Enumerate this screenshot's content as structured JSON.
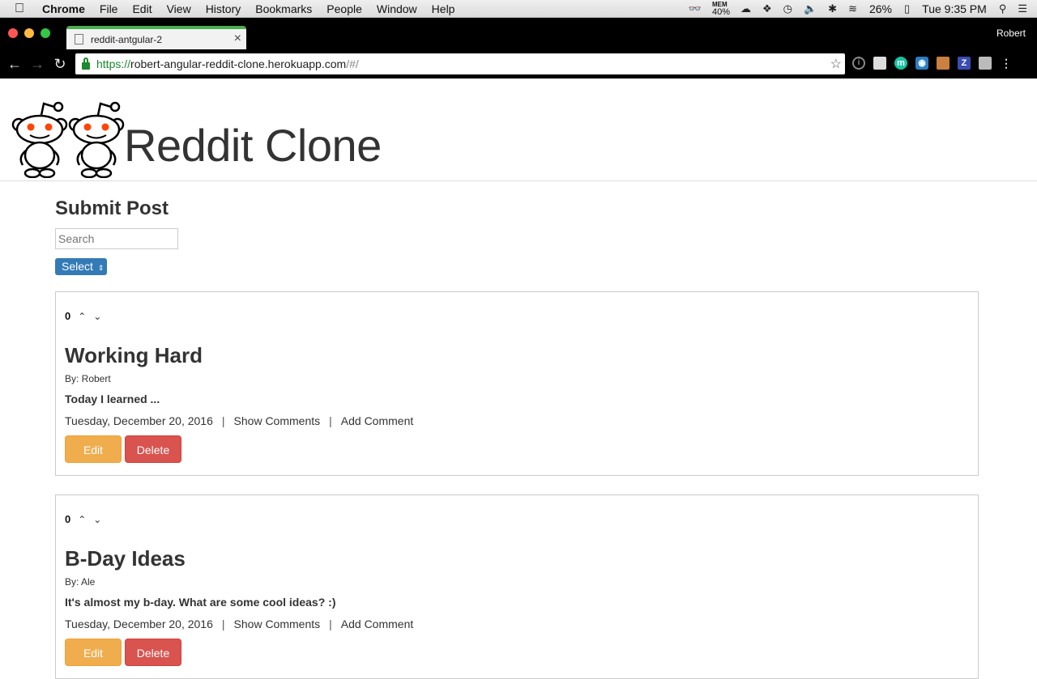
{
  "menubar": {
    "apple": "",
    "items": [
      "Chrome",
      "File",
      "Edit",
      "View",
      "History",
      "Bookmarks",
      "People",
      "Window",
      "Help"
    ],
    "mem_label": "MEM",
    "mem_value": "40%",
    "battery": "26%",
    "clock": "Tue 9:35 PM"
  },
  "browser": {
    "tab_title": "reddit-antgular-2",
    "profile": "Robert",
    "url_scheme": "https://",
    "url_host": "robert-angular-reddit-clone.herokuapp.com",
    "url_path": "/#/"
  },
  "site": {
    "title": "Reddit Clone"
  },
  "submit": {
    "heading": "Submit Post",
    "search_placeholder": "Search",
    "select_label": "Select"
  },
  "posts": [
    {
      "votes": "0",
      "title": "Working Hard",
      "author": "By: Robert",
      "body": "Today I learned ...",
      "date": "Tuesday, December 20, 2016",
      "show_comments": "Show Comments",
      "add_comment": "Add Comment",
      "edit": "Edit",
      "delete": "Delete"
    },
    {
      "votes": "0",
      "title": "B-Day Ideas",
      "author": "By: Ale",
      "body": "It's almost my b-day. What are some cool ideas? :)",
      "date": "Tuesday, December 20, 2016",
      "show_comments": "Show Comments",
      "add_comment": "Add Comment",
      "edit": "Edit",
      "delete": "Delete"
    }
  ],
  "colors": {
    "edit_button": "#f0ad4e",
    "delete_button": "#d9534f",
    "select_button": "#337ab7",
    "secure_scheme": "#1a8a2e"
  }
}
